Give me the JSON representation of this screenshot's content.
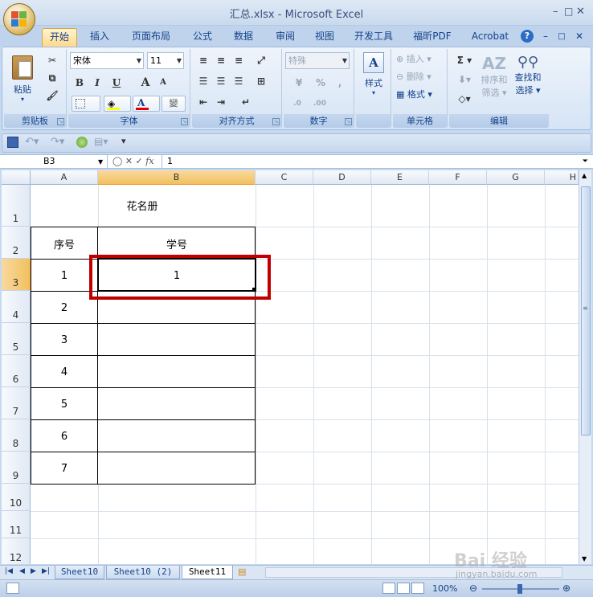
{
  "window": {
    "title": "汇总.xlsx - Microsoft Excel",
    "minimize": "–",
    "restore": "□",
    "close": "✕"
  },
  "ribbon_tabs": [
    "开始",
    "插入",
    "页面布局",
    "公式",
    "数据",
    "审阅",
    "视图",
    "开发工具",
    "福昕PDF",
    "Acrobat"
  ],
  "ribbon_right": {
    "help": "?",
    "min": "–",
    "restore": "□",
    "close": "✕"
  },
  "ribbon": {
    "clipboard": {
      "paste": "粘贴",
      "label": "剪贴板"
    },
    "font": {
      "name": "宋体",
      "size": "11",
      "label": "字体",
      "bold": "B",
      "italic": "I",
      "underline": "U",
      "grow": "A",
      "shrink": "A",
      "color_a": "A",
      "wen": "變"
    },
    "align": {
      "label": "对齐方式"
    },
    "number": {
      "format": "特殊",
      "percent": "%",
      "comma": ",",
      "label": "数字"
    },
    "styles": {
      "label_btn": "样式"
    },
    "cells": {
      "insert": "插入",
      "delete": "删除",
      "format": "格式",
      "label": "单元格"
    },
    "edit": {
      "sum": "Σ",
      "sort": "排序和",
      "sort2": "筛选",
      "find": "查找和",
      "find2": "选择",
      "label": "编辑"
    }
  },
  "formula_bar": {
    "name_box": "B3",
    "fx": "fx",
    "content": "1"
  },
  "columns": [
    "A",
    "B",
    "C",
    "D",
    "E",
    "F",
    "G",
    "H"
  ],
  "rows": [
    "1",
    "2",
    "3",
    "4",
    "5",
    "6",
    "7",
    "8",
    "9",
    "10",
    "11",
    "12"
  ],
  "sheet": {
    "title": "花名册",
    "header_a": "序号",
    "header_b": "学号",
    "a_values": [
      "1",
      "2",
      "3",
      "4",
      "5",
      "6",
      "7"
    ],
    "b3": "1"
  },
  "sheet_tabs": [
    "Sheet10",
    "Sheet10 (2)",
    "Sheet11"
  ],
  "status": {
    "zoom": "100%"
  },
  "watermark": {
    "main": "Bai 经验",
    "url": "jingyan.baidu.com"
  }
}
